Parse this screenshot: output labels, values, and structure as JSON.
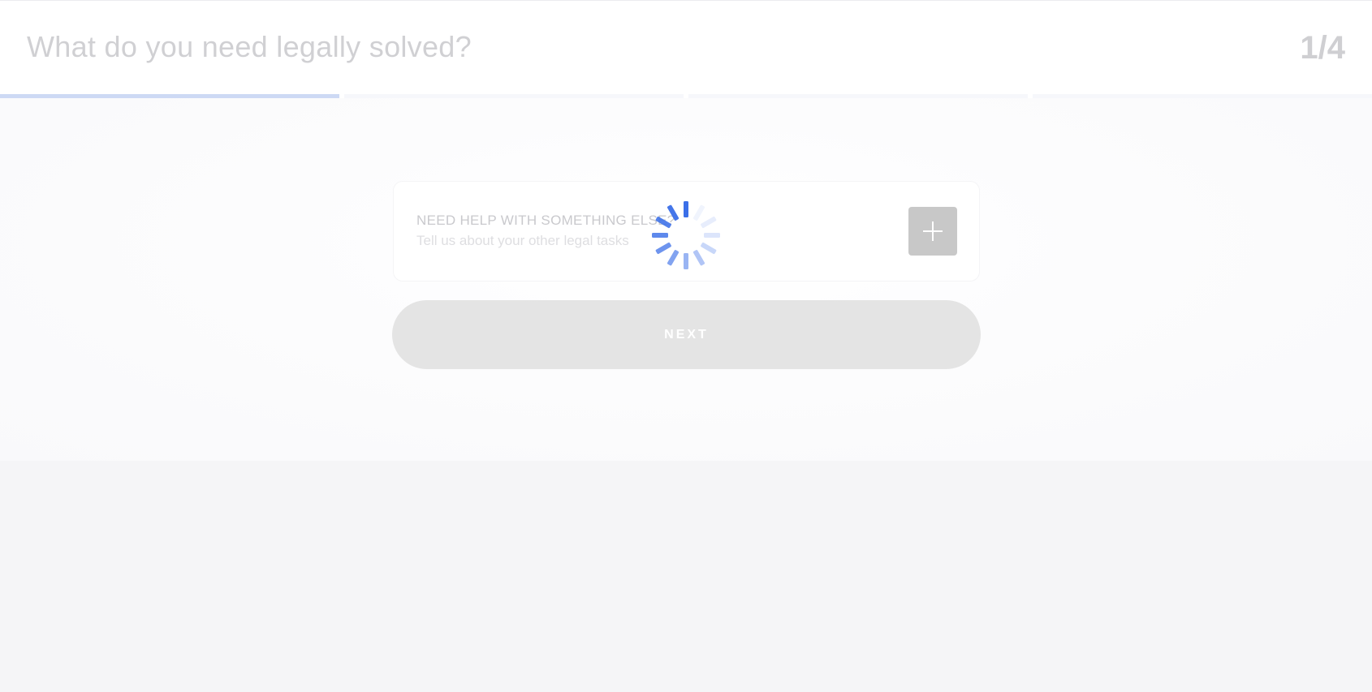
{
  "header": {
    "title": "What do you need legally solved?",
    "step": "1/4"
  },
  "progress": {
    "current_step": 1,
    "total_steps": 4
  },
  "card": {
    "title": "NEED HELP WITH SOMETHING ELSE?",
    "subtitle": "Tell us about your other legal tasks",
    "add_icon": "plus-icon"
  },
  "next_button": {
    "label": "NEXT"
  },
  "spinner": {
    "icon": "loading-spinner-icon",
    "color": "#3b6fe8"
  },
  "colors": {
    "progress_fill": "#cdd9f4",
    "add_button": "#c8c8c8",
    "next_button": "#e4e4e4",
    "page_background": "#f5f5f7"
  }
}
